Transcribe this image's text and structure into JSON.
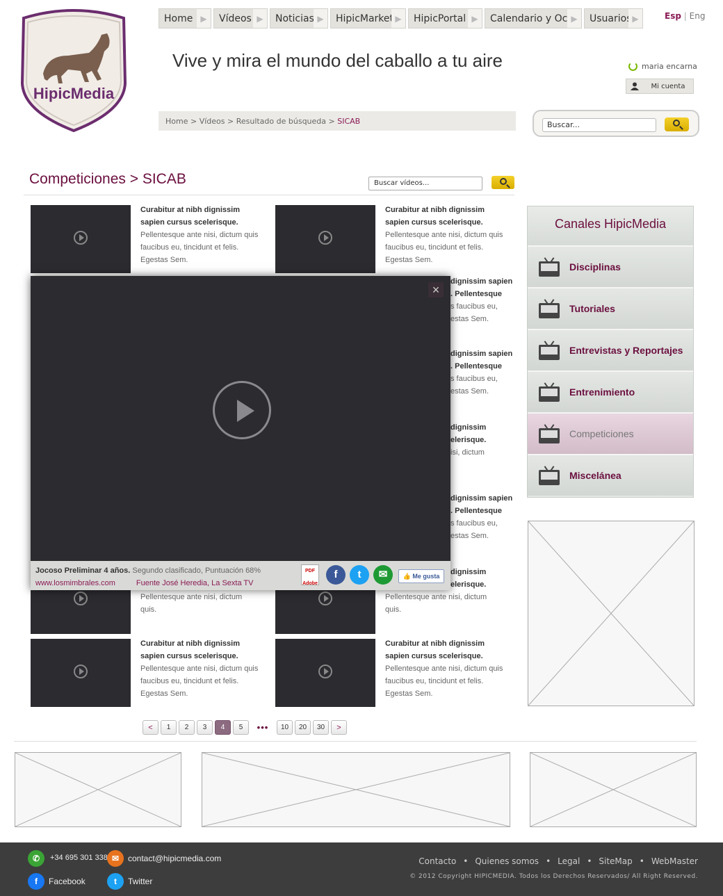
{
  "brand": {
    "name": "HipicMedia",
    "accent": "#6b0f3f",
    "logo_border": "#6b2d6e"
  },
  "nav": [
    {
      "label": "Home",
      "width": 76
    },
    {
      "label": "Vídeos",
      "width": 78
    },
    {
      "label": "Noticias",
      "width": 84
    },
    {
      "label": "HipicMarket",
      "width": 109
    },
    {
      "label": "HipicPortal",
      "width": 107
    },
    {
      "label": "Calendario y Ocio",
      "width": 140
    },
    {
      "label": "Usuarios",
      "width": 85
    }
  ],
  "lang": {
    "esp": "Esp",
    "sep": "|",
    "eng": "Eng"
  },
  "tagline": "Vive y mira el mundo del caballo a tu aire",
  "user": {
    "name": "maria encarna",
    "account_label": "Mi cuenta"
  },
  "breadcrumb": {
    "prefix": "Home > Vídeos > Resultado de búsqueda > ",
    "current": "SICAB"
  },
  "search": {
    "placeholder": "Buscar..."
  },
  "section": {
    "title": "Competiciones > SICAB",
    "search_placeholder": "Buscar vídeos..."
  },
  "videos": [
    {
      "title": "Curabitur at nibh dignissim sapien cursus scelerisque.",
      "text": " Pellentesque ante nisi, dictum quis faucibus eu, tincidunt et felis. Egestas Sem."
    },
    {
      "title": "Curabitur at nibh dignissim sapien cursus scelerisque.",
      "text": " Pellentesque ante nisi, dictum quis faucibus eu, tincidunt et felis. Egestas Sem."
    },
    {
      "title": "Curabitur at nibh dignissim sapien cursus scelerisque.",
      "text": " Pellentesque ante nisi, dictum quis faucibus eu, tincidunt et felis. Egestas Sem."
    },
    {
      "title": "Curabitur at nibh dignissim sapien cursus scelerisque.",
      "text": " Pellentesque ante nisi, dictum quis faucibus eu, tincidunt et felis. Egestas Sem."
    },
    {
      "title": "Curabitur at nibh dignissim sapien cursus scelerisque.",
      "text": " Pellentesque ante nisi, dictum quis faucibus eu, tincidunt et felis. Egestas Sem."
    },
    {
      "title": "Curabitur at nibh dignissim sapien cursus scelerisque.",
      "text": " Pellentesque ante nisi, dictum quis faucibus eu, tincidunt et felis. Egestas Sem."
    }
  ],
  "peek": [
    {
      "l1": "dignissim sapien",
      "l2": ". Pellentesque",
      "l3": "s faucibus eu,",
      "l4": "estas Sem."
    },
    {
      "l1": "dignissim sapien",
      "l2": ". Pellentesque",
      "l3": "s faucibus eu,",
      "l4": "estas Sem."
    },
    {
      "l1": "dignissim",
      "l2": "elerisque.",
      "l3": "isi, dictum",
      "l4": ""
    },
    {
      "l1": "dignissim sapien",
      "l2": ". Pellentesque",
      "l3": "s faucibus eu,",
      "l4": "estas Sem."
    },
    {
      "l1": "dignissim",
      "l2": "elerisque.",
      "l3": "",
      "l4": ""
    }
  ],
  "row6": {
    "text": "Pellentesque ante nisi, dictum quis."
  },
  "channels": {
    "title": "Canales HipicMedia",
    "items": [
      "Disciplinas",
      "Tutoriales",
      "Entrevistas y Reportajes",
      "Entrenimiento",
      "Competiciones",
      "Miscelánea"
    ],
    "active_index": 4
  },
  "pagination": {
    "prev": "<",
    "pages": [
      "1",
      "2",
      "3",
      "4",
      "5"
    ],
    "current": "4",
    "dots": "•••",
    "more": [
      "10",
      "20",
      "30"
    ],
    "next": ">"
  },
  "modal": {
    "title": "Jocoso Preliminar 4 años.",
    "subtitle": " Segundo clasificado, Puntuación 68%",
    "link": "www.losmimbrales.com",
    "source": "Fuente José Heredia, La Sexta TV",
    "close": "×",
    "pdf": "PDF",
    "pdf_sub": "Adobe",
    "like": "Me gusta"
  },
  "footer": {
    "phone": "+34 695 301 338",
    "email": "contact@hipicmedia.com",
    "facebook": "Facebook",
    "twitter": "Twitter",
    "links": [
      "Contacto",
      "Quienes somos",
      "Legal",
      "SiteMap",
      "WebMaster"
    ],
    "copyright": "© 2012 Copyright HIPICMEDIA. Todos los Derechos Reservados/ All Right Reserved."
  }
}
